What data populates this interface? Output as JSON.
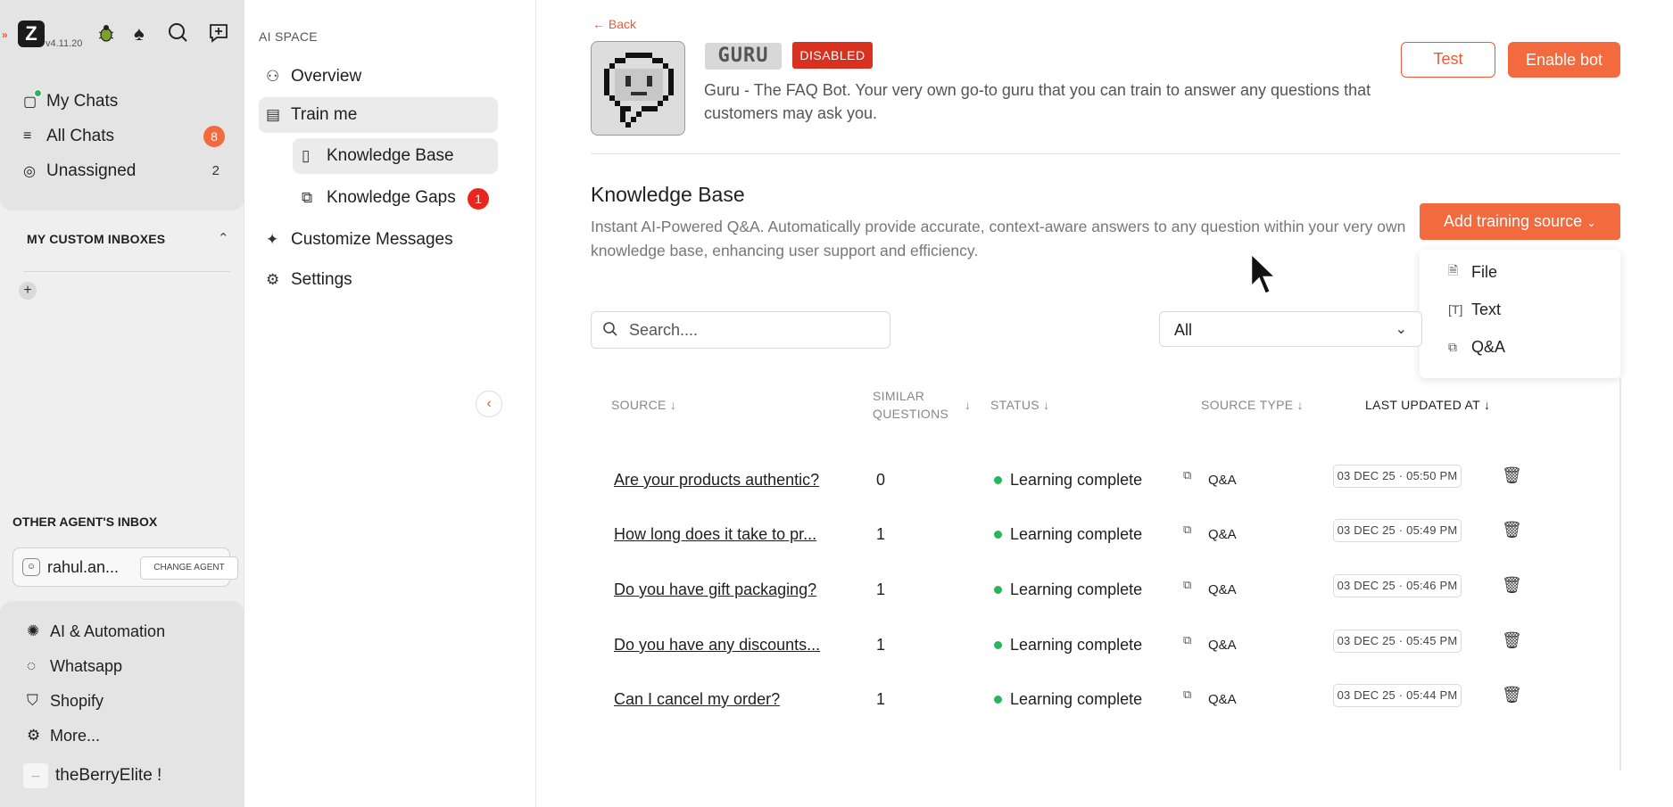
{
  "app": {
    "version": "v4.11.20"
  },
  "rail": {
    "main_items": [
      {
        "label": "My Chats"
      },
      {
        "label": "All Chats",
        "badge": "8"
      },
      {
        "label": "Unassigned",
        "count": "2"
      }
    ],
    "custom_inboxes_header": "MY CUSTOM INBOXES",
    "other_inbox_header": "OTHER AGENT'S INBOX",
    "agent_name": "rahul.an...",
    "change_agent_label": "CHANGE AGENT",
    "bottom_items": [
      {
        "label": "AI & Automation"
      },
      {
        "label": "Whatsapp"
      },
      {
        "label": "Shopify"
      },
      {
        "label": "More..."
      }
    ],
    "store_name": "theBerryElite !"
  },
  "midnav": {
    "section_header": "AI SPACE",
    "items": [
      {
        "label": "Overview"
      },
      {
        "label": "Train me"
      },
      {
        "label": "Knowledge Base"
      },
      {
        "label": "Knowledge Gaps",
        "badge": "1"
      },
      {
        "label": "Customize Messages"
      },
      {
        "label": "Settings"
      }
    ]
  },
  "main": {
    "back_label": "Back",
    "bot": {
      "name": "GURU",
      "status": "DISABLED",
      "description": "Guru - The FAQ Bot. Your very own go-to guru that you can train to answer any questions that customers may ask you."
    },
    "test_label": "Test",
    "enable_label": "Enable bot",
    "kb_title": "Knowledge Base",
    "kb_description": "Instant AI-Powered Q&A. Automatically provide accurate, context-aware answers to any question within your very own knowledge base, enhancing user support and efficiency.",
    "add_source_label": "Add training source",
    "add_source_menu": [
      {
        "label": "File"
      },
      {
        "label": "Text"
      },
      {
        "label": "Q&A"
      }
    ],
    "search_placeholder": "Search....",
    "filter_value": "All",
    "columns": {
      "source": "SOURCE",
      "similar_1": "SIMILAR",
      "similar_2": "QUESTIONS",
      "status": "STATUS",
      "source_type": "SOURCE TYPE",
      "last_updated": "LAST UPDATED AT"
    },
    "rows": [
      {
        "source": "Are your products authentic?",
        "similar": "0",
        "status": "Learning complete",
        "type": "Q&A",
        "updated": "03 DEC 25 · 05:50 PM"
      },
      {
        "source": "How long does it take to pr...",
        "similar": "1",
        "status": "Learning complete",
        "type": "Q&A",
        "updated": "03 DEC 25 · 05:49 PM"
      },
      {
        "source": "Do you have gift packaging?",
        "similar": "1",
        "status": "Learning complete",
        "type": "Q&A",
        "updated": "03 DEC 25 · 05:46 PM"
      },
      {
        "source": "Do you have any discounts...",
        "similar": "1",
        "status": "Learning complete",
        "type": "Q&A",
        "updated": "03 DEC 25 · 05:45 PM"
      },
      {
        "source": "Can I cancel my order?",
        "similar": "1",
        "status": "Learning complete",
        "type": "Q&A",
        "updated": "03 DEC 25 · 05:44 PM"
      }
    ]
  },
  "colors": {
    "accent": "#f26a3e",
    "danger": "#d93120",
    "success": "#2bb45e"
  }
}
